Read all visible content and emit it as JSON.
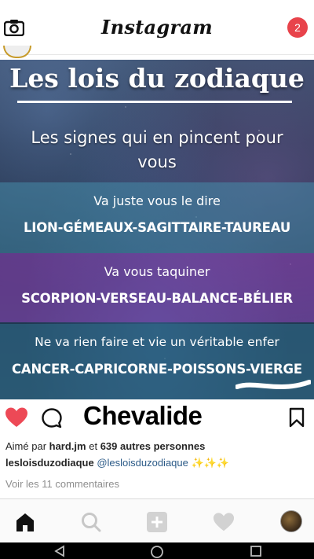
{
  "app": {
    "title": "Instagram",
    "notification_count": "2"
  },
  "post": {
    "image_text": {
      "title": "Les lois du zodiaque",
      "subtitle": "Les signes qui en pincent pour vous",
      "bands": [
        {
          "intro": "Va juste vous le dire",
          "signs": "LION-GÉMEAUX-SAGITTAIRE-TAUREAU"
        },
        {
          "intro": "Va vous taquiner",
          "signs": "SCORPION-VERSEAU-BALANCE-BÉLIER"
        },
        {
          "intro": "Ne va rien faire et vie un véritable enfer",
          "signs": "CANCER-CAPRICORNE-POISSONS-VIERGE"
        }
      ]
    },
    "overlay_name": "Chevalide",
    "likes_prefix": "Aimé par ",
    "likes_user": "hard.jm",
    "likes_mid": " et ",
    "likes_count": "639 autres personnes",
    "caption_user": "lesloisduzodiaque",
    "caption_mention": "@lesloisduzodiaque",
    "caption_emoji": "✨✨✨",
    "view_comments": "Voir les 11 commentaires"
  },
  "colors": {
    "like_red": "#ed4956",
    "notification_red": "#e8434b",
    "mention_blue": "#2b5a87"
  },
  "icons": {
    "top_left": "camera-icon",
    "like": "heart-filled-icon",
    "comment": "comment-icon",
    "save": "bookmark-icon",
    "nav": [
      "home-icon",
      "search-icon",
      "add-post-icon",
      "activity-heart-icon",
      "profile-avatar"
    ],
    "system": [
      "back-icon",
      "home-circle-icon",
      "recents-icon"
    ]
  }
}
